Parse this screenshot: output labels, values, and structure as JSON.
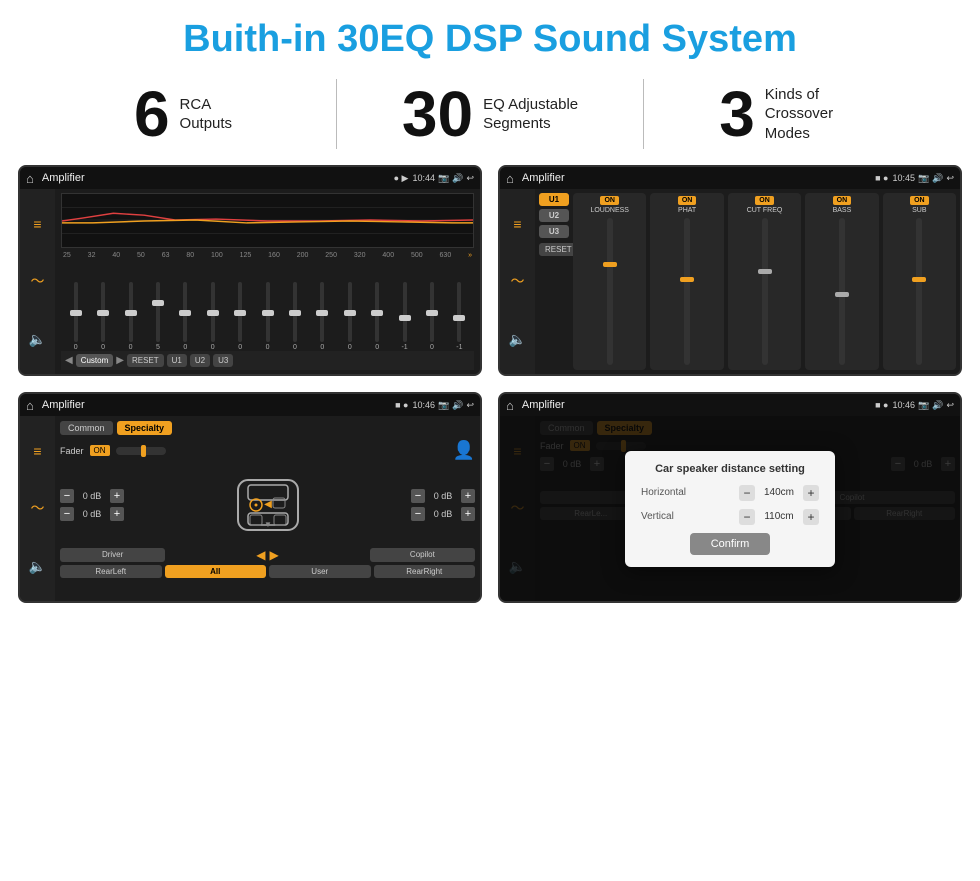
{
  "page": {
    "title": "Buith-in 30EQ DSP Sound System"
  },
  "stats": [
    {
      "number": "6",
      "label_line1": "RCA",
      "label_line2": "Outputs"
    },
    {
      "number": "30",
      "label_line1": "EQ Adjustable",
      "label_line2": "Segments"
    },
    {
      "number": "3",
      "label_line1": "Kinds of",
      "label_line2": "Crossover Modes"
    }
  ],
  "screens": [
    {
      "id": "screen1",
      "status_time": "10:44",
      "app_title": "Amplifier",
      "eq_freqs": [
        "25",
        "32",
        "40",
        "50",
        "63",
        "80",
        "100",
        "125",
        "160",
        "200",
        "250",
        "320",
        "400",
        "500",
        "630"
      ],
      "eq_values": [
        "0",
        "0",
        "0",
        "5",
        "0",
        "0",
        "0",
        "0",
        "0",
        "0",
        "0",
        "0",
        "-1",
        "0",
        "-1"
      ],
      "preset": "Custom",
      "buttons": [
        "RESET",
        "U1",
        "U2",
        "U3"
      ]
    },
    {
      "id": "screen2",
      "status_time": "10:45",
      "app_title": "Amplifier",
      "u_buttons": [
        "U1",
        "U2",
        "U3"
      ],
      "bands": [
        "LOUDNESS",
        "PHAT",
        "CUT FREQ",
        "BASS",
        "SUB"
      ],
      "reset_label": "RESET"
    },
    {
      "id": "screen3",
      "status_time": "10:46",
      "app_title": "Amplifier",
      "tabs": [
        "Common",
        "Specialty"
      ],
      "fader_label": "Fader",
      "fader_on": "ON",
      "db_values": [
        "0 dB",
        "0 dB",
        "0 dB",
        "0 dB"
      ],
      "bottom_buttons": [
        "Driver",
        "",
        "Copilot",
        "RearLeft",
        "All",
        "",
        "User",
        "RearRight"
      ]
    },
    {
      "id": "screen4",
      "status_time": "10:46",
      "app_title": "Amplifier",
      "tabs": [
        "Common",
        "Specialty"
      ],
      "dialog": {
        "title": "Car speaker distance setting",
        "horizontal_label": "Horizontal",
        "horizontal_value": "140cm",
        "vertical_label": "Vertical",
        "vertical_value": "110cm",
        "confirm_label": "Confirm",
        "db_values": [
          "0 dB",
          "0 dB"
        ]
      }
    }
  ]
}
